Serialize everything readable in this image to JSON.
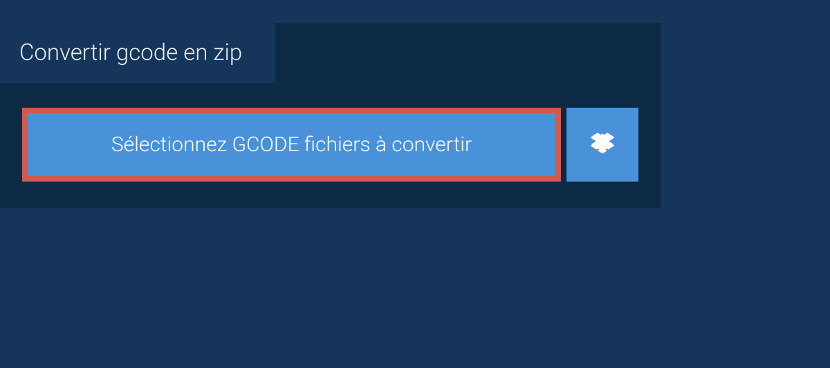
{
  "tab": {
    "title": "Convertir gcode en zip"
  },
  "actions": {
    "select_label": "Sélectionnez GCODE fichiers à convertir"
  },
  "colors": {
    "page_bg": "#15365a",
    "panel_bg": "#0d2a44",
    "button_bg": "#4991d8",
    "highlight_border": "#cf5a4d"
  }
}
